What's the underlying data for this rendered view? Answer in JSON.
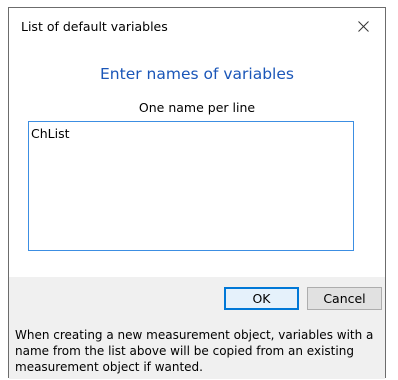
{
  "window": {
    "title": "List of default variables",
    "close_icon": "close-icon"
  },
  "main": {
    "heading": "Enter names of variables",
    "subheading": "One name per line",
    "variables_text": "ChList"
  },
  "buttons": {
    "ok_label": "OK",
    "cancel_label": "Cancel"
  },
  "footer": {
    "note": "When creating a new measurement object, variables with a name from the list above will be copied from an existing measurement object if wanted."
  },
  "colors": {
    "heading": "#1a56b8",
    "textarea_border": "#3c8ee2",
    "default_button_border": "#0078d7",
    "button_bar_bg": "#f0f0f0"
  }
}
